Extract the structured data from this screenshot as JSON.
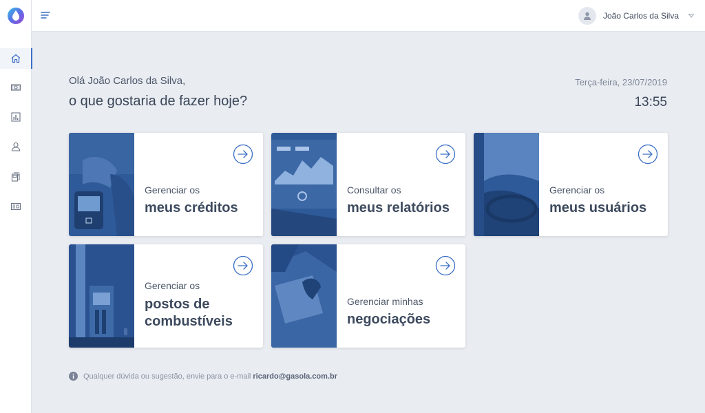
{
  "header": {
    "user_name": "João Carlos da Silva"
  },
  "greeting": {
    "hello": "Olá João Carlos da Silva,",
    "question": "o que gostaria de fazer hoje?",
    "date": "Terça-feira, 23/07/2019",
    "time": "13:55"
  },
  "cards": [
    {
      "sub": "Gerenciar os",
      "title": "meus créditos"
    },
    {
      "sub": "Consultar os",
      "title": "meus relatórios"
    },
    {
      "sub": "Gerenciar os",
      "title": "meus usuários"
    },
    {
      "sub": "Gerenciar os",
      "title_line1": "postos de",
      "title_line2": "combustíveis"
    },
    {
      "sub": "Gerenciar minhas",
      "title": "negociações"
    }
  ],
  "footer": {
    "note": "Qualquer dúvida ou sugestão, envie para o e-mail",
    "email": "ricardo@gasola.com.br"
  },
  "colors": {
    "accent": "#3b6fc4",
    "card_image_tint": "#2f5a99",
    "background": "#e9ecf1"
  },
  "icons": {
    "sidebar": [
      "home-icon",
      "money-icon",
      "report-icon",
      "user-icon",
      "fuel-icon",
      "handshake-icon"
    ],
    "card": "arrow-right-circle-icon"
  }
}
